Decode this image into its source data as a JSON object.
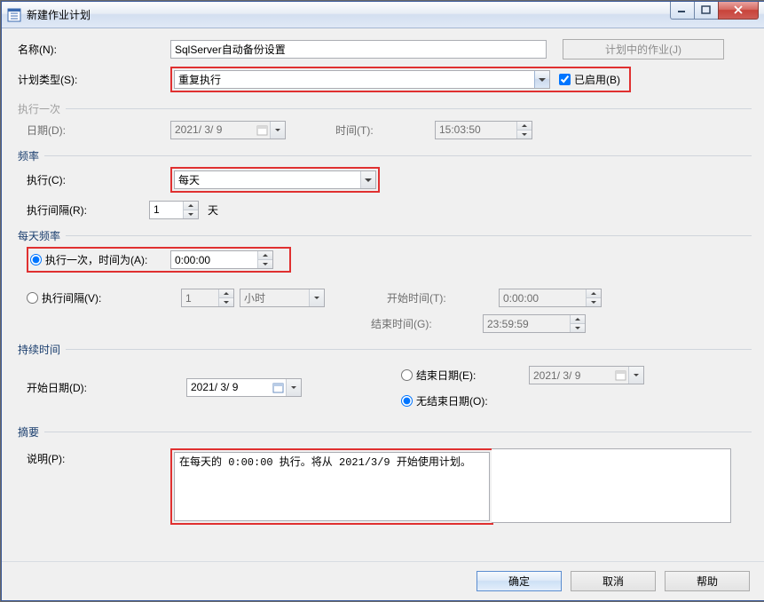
{
  "window": {
    "title": "新建作业计划"
  },
  "name": {
    "label": "名称(N):",
    "value": "SqlServer自动备份设置"
  },
  "jobs_in_schedule_btn": "计划中的作业(J)",
  "schedule_type": {
    "label": "计划类型(S):",
    "value": "重复执行"
  },
  "enabled": {
    "label": "已启用(B)",
    "checked": true
  },
  "once": {
    "section": "执行一次",
    "date_label": "日期(D):",
    "date_value": "2021/ 3/ 9",
    "time_label": "时间(T):",
    "time_value": "15:03:50"
  },
  "freq": {
    "section": "频率",
    "occurs_label": "执行(C):",
    "occurs_value": "每天",
    "recurs_label": "执行间隔(R):",
    "recurs_value": "1",
    "recurs_unit": "天"
  },
  "daily": {
    "section": "每天频率",
    "once_label": "执行一次，时间为(A):",
    "once_value": "0:00:00",
    "every_label": "执行间隔(V):",
    "every_value": "1",
    "every_unit": "小时",
    "start_label": "开始时间(T):",
    "start_value": "0:00:00",
    "end_label": "结束时间(G):",
    "end_value": "23:59:59"
  },
  "duration": {
    "section": "持续时间",
    "start_label": "开始日期(D):",
    "start_value": "2021/ 3/ 9",
    "end_radio": "结束日期(E):",
    "end_value": "2021/ 3/ 9",
    "noend_radio": "无结束日期(O):"
  },
  "summary": {
    "section": "摘要",
    "desc_label": "说明(P):",
    "desc_value": "在每天的 0:00:00 执行。将从 2021/3/9 开始使用计划。"
  },
  "buttons": {
    "ok": "确定",
    "cancel": "取消",
    "help": "帮助"
  }
}
